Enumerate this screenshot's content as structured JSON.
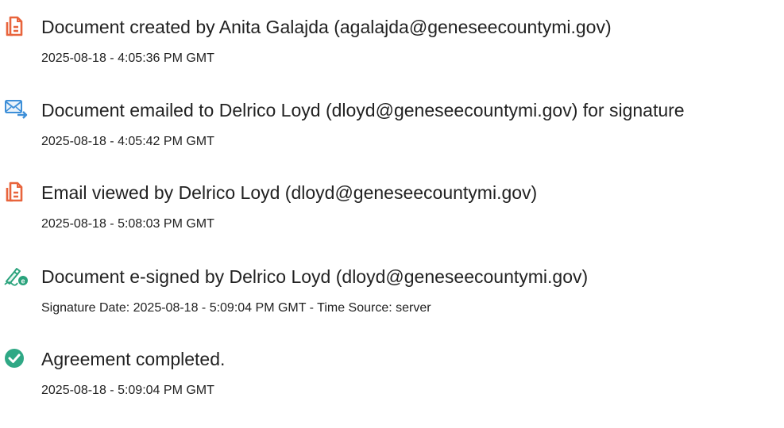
{
  "events": [
    {
      "icon": "document-created-icon",
      "title": "Document created by Anita Galajda (agalajda@geneseecountymi.gov)",
      "detail": "2025-08-18 - 4:05:36 PM GMT"
    },
    {
      "icon": "email-sent-icon",
      "title": "Document emailed to Delrico Loyd (dloyd@geneseecountymi.gov) for signature",
      "detail": "2025-08-18 - 4:05:42 PM GMT"
    },
    {
      "icon": "email-viewed-icon",
      "title": "Email viewed by Delrico Loyd (dloyd@geneseecountymi.gov)",
      "detail": "2025-08-18 - 5:08:03 PM GMT"
    },
    {
      "icon": "e-sign-icon",
      "title": "Document e-signed by Delrico Loyd (dloyd@geneseecountymi.gov)",
      "detail": "Signature Date: 2025-08-18 - 5:09:04 PM GMT - Time Source: server"
    },
    {
      "icon": "check-circle-icon",
      "title": "Agreement completed.",
      "detail": "2025-08-18 - 5:09:04 PM GMT"
    }
  ],
  "colors": {
    "document_icon": "#e8643c",
    "email_icon": "#3d8fd8",
    "sign_icon": "#2aa37c",
    "check_icon": "#2fa885"
  }
}
